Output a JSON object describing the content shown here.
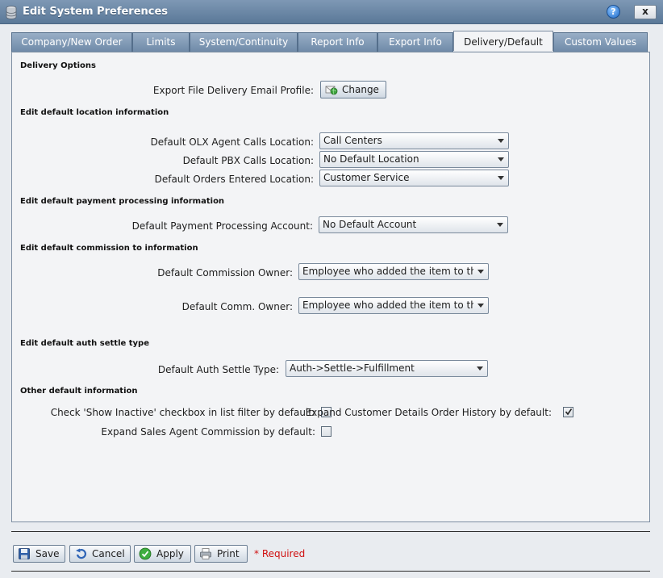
{
  "window": {
    "title": "Edit System Preferences",
    "help_label": "?",
    "close_label": "x"
  },
  "tabs": [
    {
      "label": "Company/New Order",
      "active": false
    },
    {
      "label": "Limits",
      "active": false
    },
    {
      "label": "System/Continuity",
      "active": false
    },
    {
      "label": "Report Info",
      "active": false
    },
    {
      "label": "Export Info",
      "active": false
    },
    {
      "label": "Delivery/Default",
      "active": true
    },
    {
      "label": "Custom Values",
      "active": false
    }
  ],
  "delivery": {
    "heading": "Delivery Options",
    "email_profile_label": "Export File Delivery Email Profile:",
    "change_button": "Change"
  },
  "location": {
    "heading": "Edit default location information",
    "olx_label": "Default OLX Agent Calls Location:",
    "olx_value": "Call Centers",
    "pbx_label": "Default PBX Calls Location:",
    "pbx_value": "No Default Location",
    "orders_label": "Default Orders Entered Location:",
    "orders_value": "Customer Service"
  },
  "payment": {
    "heading": "Edit default payment processing information",
    "account_label": "Default Payment Processing Account:",
    "account_value": "No Default Account"
  },
  "commission": {
    "heading": "Edit default commission to information",
    "owner_label": "Default Commission Owner:",
    "owner_value": "Employee who added the item to the o",
    "comm_owner_label": "Default Comm. Owner:",
    "comm_owner_value": "Employee who added the item to the o"
  },
  "auth": {
    "heading": "Edit default auth settle type",
    "type_label": "Default Auth Settle Type:",
    "type_value": "Auth->Settle->Fulfillment"
  },
  "other": {
    "heading": "Other default information",
    "show_inactive_label": "Check 'Show Inactive' checkbox in list filter by default:",
    "show_inactive_checked": false,
    "expand_history_label": "Expand Customer Details Order History by default:",
    "expand_history_checked": true,
    "expand_commission_label": "Expand Sales Agent Commission by default:",
    "expand_commission_checked": false
  },
  "footer": {
    "save": "Save",
    "cancel": "Cancel",
    "apply": "Apply",
    "print": "Print",
    "required": "* Required"
  },
  "colors": {
    "titlebar": "#5a7898",
    "tab_inactive": "#7f98b5",
    "panel": "#f3f4f6",
    "required": "#d01010"
  },
  "icons": {
    "title": "database-icon",
    "change": "email-globe-icon",
    "save": "floppy-disk-icon",
    "cancel": "undo-arrow-icon",
    "apply": "checkmark-circle-icon",
    "print": "printer-icon"
  }
}
